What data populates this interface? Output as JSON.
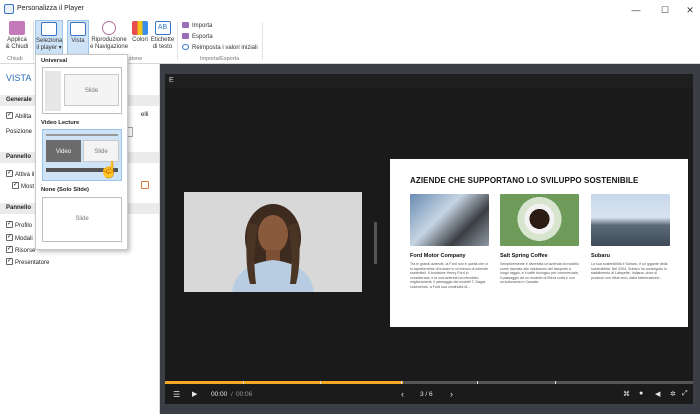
{
  "window": {
    "title": "Personalizza il Player",
    "minimize": "—",
    "maximize": "☐",
    "close": "✕"
  },
  "ribbon": {
    "buttons": [
      {
        "label": "Applica\n& Chiudi"
      },
      {
        "label": "Seleziona\nil player ▾"
      },
      {
        "label": "Vista"
      },
      {
        "label": "Riproduzione\ne Navigazione"
      },
      {
        "label": "Colori"
      },
      {
        "label": "Etichette\ndi testo"
      }
    ],
    "import_label": "Importa",
    "export_label": "Esporta",
    "reset_label": "Reimposta i valori iniziali",
    "groups": {
      "close": "Chiudi",
      "customize": "zione",
      "import_export": "Importa/Esporta"
    }
  },
  "left_panel": {
    "title": "VISTA",
    "sections": {
      "general": "Generale",
      "sidebar": "Pannello",
      "sidebar2": "Pannello"
    },
    "rows": {
      "enable": "Abilita",
      "enable_suffix": "elli",
      "position": "Posizione",
      "activate": "Attiva il",
      "show": "Most",
      "profile": "Profilo",
      "modules": "Modali",
      "resources": "Risorse",
      "presenter": "Presentatore"
    }
  },
  "menu": {
    "universal_label": "Universal",
    "universal_slide": "Slide",
    "lecture_label": "Video Lecture",
    "lecture_video": "Video",
    "lecture_slide": "Slide",
    "none_label": "None (Solo Slide)",
    "none_slide": "Slide"
  },
  "player": {
    "top_letter": "E",
    "slide": {
      "title": "AZIENDE CHE SUPPORTANO LO SVILUPPO SOSTENIBILE",
      "columns": [
        {
          "title": "Ford Motor Company",
          "text": "Tra le grandi aziende, la Ford non è quella che ci si aspetterebbe di trovare in un'elenco di aziende sostenibili. Il fondatore Henry Ford lo considerava, e la sua azienda ha introdotto miglioramenti, il paesaggio dei modelli T, Dagat, costruendo, a Ford sua continuità di..."
        },
        {
          "title": "Salt Spring Coffee",
          "text": "Semplicemente è diventata un'azienda di modello come risposta alle valutazioni del trasporto a lungo raggio, e il caffè biologico per commerciale, il passaggio ad un modello di filiera corta e con un'autonoma in Canada."
        },
        {
          "title": "Subaru",
          "text": "La sua sostenibilità è Subaru, è un gigante della sostenibilità. Nel 2004, Subaru ha conseguito lo stabilimento di Lafayette, Indiana, dove si produce con rifiuti zero, dalla fabbricazione..."
        }
      ]
    },
    "time_current": "00:00",
    "time_sep": "/",
    "time_total": "00:06",
    "page": "3 / 6",
    "progress_fraction": 0.45
  }
}
